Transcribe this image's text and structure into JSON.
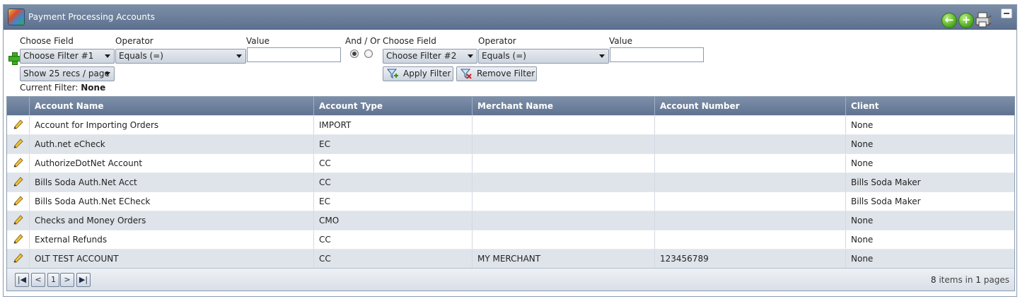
{
  "window": {
    "title": "Payment Processing Accounts"
  },
  "toolbar": {
    "back_icon": "back-arrow-icon",
    "add_icon": "add-icon",
    "print_icon": "printer-icon",
    "minimize_icon": "minimize-icon"
  },
  "filter": {
    "choose_field_label": "Choose Field",
    "operator_label": "Operator",
    "value_label": "Value",
    "and_or_label": "And / Or",
    "field1": "Choose Filter #1",
    "operator1": "Equals (=)",
    "value1": "",
    "field2": "Choose Filter #2",
    "operator2": "Equals (=)",
    "value2": "",
    "and_or_selected": "And",
    "page_size": "Show 25 recs / page",
    "apply_label": "Apply Filter",
    "remove_label": "Remove Filter",
    "current_filter_label": "Current Filter:",
    "current_filter_value": "None"
  },
  "grid": {
    "columns": [
      "Account Name",
      "Account Type",
      "Merchant Name",
      "Account Number",
      "Client"
    ],
    "rows": [
      [
        "Account for Importing Orders",
        "IMPORT",
        "",
        "",
        "None"
      ],
      [
        "Auth.net eCheck",
        "EC",
        "",
        "",
        "None"
      ],
      [
        "AuthorizeDotNet Account",
        "CC",
        "",
        "",
        "None"
      ],
      [
        "Bills Soda Auth.Net Acct",
        "CC",
        "",
        "",
        "Bills Soda Maker"
      ],
      [
        "Bills Soda Auth.Net ECheck",
        "EC",
        "",
        "",
        "Bills Soda Maker"
      ],
      [
        "Checks and Money Orders",
        "CMO",
        "",
        "",
        "None"
      ],
      [
        "External Refunds",
        "CC",
        "",
        "",
        "None"
      ],
      [
        "OLT TEST ACCOUNT",
        "CC",
        "MY MERCHANT",
        "123456789",
        "None"
      ]
    ]
  },
  "pager": {
    "first": "K",
    "prev": "<",
    "current_page": "1",
    "next": ">",
    "last": ">|",
    "item_count": "8",
    "items_text": "items in",
    "page_count": "1",
    "pages_text": "pages"
  },
  "colors": {
    "header_bg": "#6a7e9b",
    "alt_row": "#dfe4ea",
    "accent_green": "#4aa61c"
  }
}
